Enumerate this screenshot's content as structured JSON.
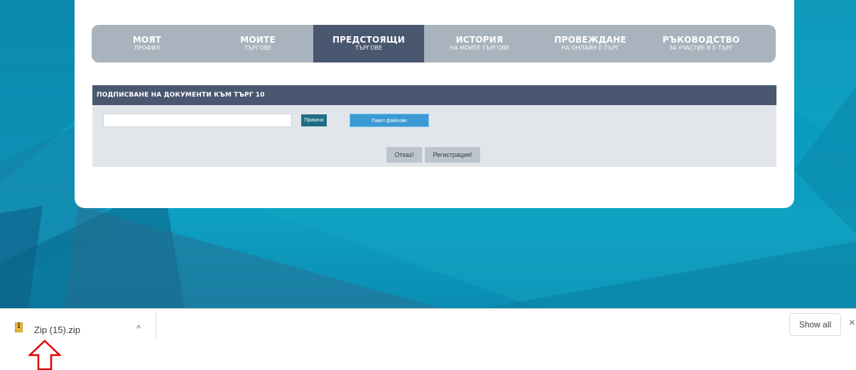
{
  "tabs": [
    {
      "line1": "МОЯТ",
      "line2": "ПРОФИЛ",
      "active": false
    },
    {
      "line1": "МОИТЕ",
      "line2": "ТЪРГОВЕ",
      "active": false
    },
    {
      "line1": "ПРЕДСТОЯЩИ",
      "line2": "ТЪРГОВЕ",
      "active": true
    },
    {
      "line1": "ИСТОРИЯ",
      "line2": "НА МОИТЕ ТЪРГОВЕ",
      "active": false
    },
    {
      "line1": "ПРОВЕЖДАНЕ",
      "line2": "НА ОНЛАЙН Е-ТЪРГ",
      "active": false
    },
    {
      "line1": "РЪКОВОДСТВО",
      "line2": "ЗА УЧАСТИЕ В Е-ТЪРГ",
      "active": false
    }
  ],
  "panel": {
    "title": "ПОДПИСВАНЕ НА ДОКУМЕНТИ КЪМ ТЪРГ 10",
    "file_value": "",
    "attach_label": "Прикачи",
    "package_label": "Пакет файлове",
    "cancel_label": "Отказ!",
    "register_label": "Регистрация!"
  },
  "download_shelf": {
    "file_name": "Zip (15).zip",
    "file_icon": "zip-file-icon",
    "chevron": "^",
    "show_all_label": "Show all",
    "close_glyph": "×"
  },
  "colors": {
    "tab_bar": "#a8b3bd",
    "tab_active": "#4a5770",
    "panel_head": "#4a5770",
    "panel_bg": "#e2e6ea",
    "attach_btn": "#1f6e85",
    "package_btn": "#3a9bd4",
    "page_bg": "#0a9dc0",
    "annotation_arrow": "#e00000"
  }
}
